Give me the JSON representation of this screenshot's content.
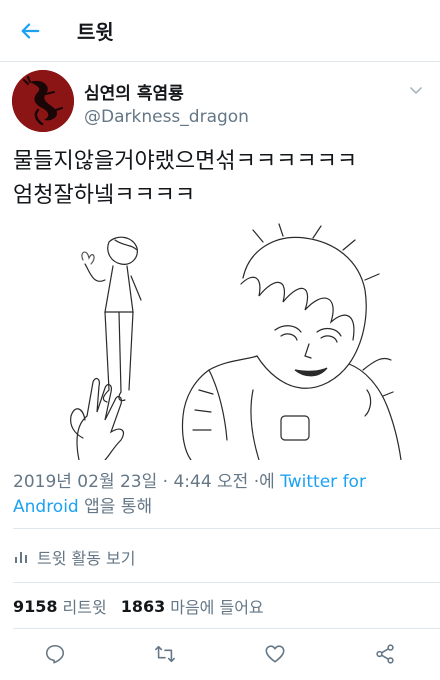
{
  "header": {
    "title": "트윗",
    "back_icon": "arrow-left-icon",
    "accent": "#1da1f2"
  },
  "tweet": {
    "author_name": "심연의 흑염룡",
    "author_handle": "@Darkness_dragon",
    "avatar_icon": "dragon-avatar",
    "text_line1": "물들지않을거야랬으면섞ㅋㅋㅋㅋㅋㅋ",
    "text_line2": "엄청잘하넼ㅋㅋㅋㅋ",
    "date_part": "2019년 02월 23일 · 4:44 오전 ·에 ",
    "source_link": "Twitter for Android",
    "source_suffix": " 앱을 통해"
  },
  "activity": {
    "label": "트윗 활동 보기",
    "icon": "bar-chart-icon"
  },
  "stats": {
    "retweets": "9158",
    "retweets_label": "리트윗",
    "likes": "1863",
    "likes_label": "마음에 들어요"
  },
  "actions": {
    "reply_icon": "reply-icon",
    "retweet_icon": "retweet-icon",
    "like_icon": "heart-icon",
    "share_icon": "share-icon"
  },
  "colors": {
    "secondary_text": "#657786",
    "primary_text": "#14171a",
    "divider": "#e1e8ed",
    "avatar_bg": "#8b1515"
  }
}
